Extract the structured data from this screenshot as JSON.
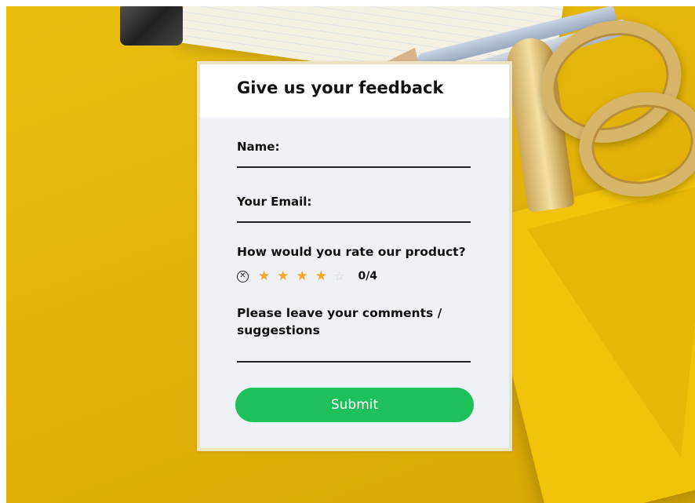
{
  "form": {
    "title": "Give us your feedback",
    "name_label": "Name:",
    "name_value": "",
    "email_label": "Your Email:",
    "email_value": "",
    "rating_question": "How would you rate our product?",
    "rating": {
      "clear_icon": "clear-circle-icon",
      "max": 5,
      "selected": 4,
      "value_text": "0/4",
      "filled_color": "#f5a623",
      "empty_color": "#cfd4dc"
    },
    "comments_label": "Please leave your comments / suggestions",
    "comments_value": "",
    "submit_label": "Submit"
  },
  "colors": {
    "submit_bg": "#1ec05a",
    "card_bg": "#eef2f7",
    "background": "#e3b20a"
  }
}
